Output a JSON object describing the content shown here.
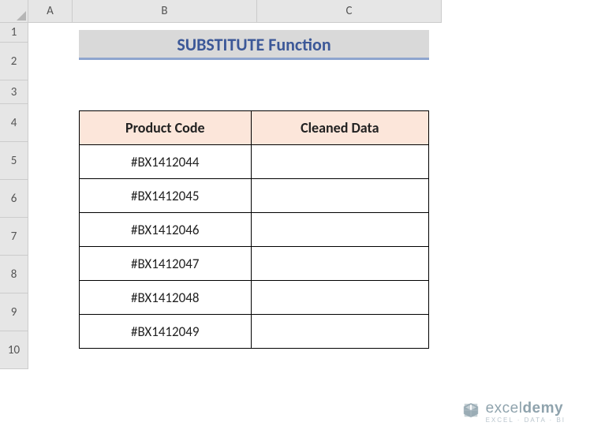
{
  "grid": {
    "columns": [
      "A",
      "B",
      "C"
    ],
    "rows": [
      "1",
      "2",
      "3",
      "4",
      "5",
      "6",
      "7",
      "8",
      "9",
      "10"
    ]
  },
  "title": "SUBSTITUTE Function",
  "table": {
    "headers": {
      "col1": "Product Code",
      "col2": "Cleaned Data"
    },
    "rows": [
      {
        "code": "#BX1412044",
        "cleaned": ""
      },
      {
        "code": "#BX1412045",
        "cleaned": ""
      },
      {
        "code": "#BX1412046",
        "cleaned": ""
      },
      {
        "code": "#BX1412047",
        "cleaned": ""
      },
      {
        "code": "#BX1412048",
        "cleaned": ""
      },
      {
        "code": "#BX1412049",
        "cleaned": ""
      }
    ]
  },
  "watermark": {
    "brand_prefix": "excel",
    "brand_suffix": "demy",
    "tagline": "EXCEL · DATA · BI"
  }
}
